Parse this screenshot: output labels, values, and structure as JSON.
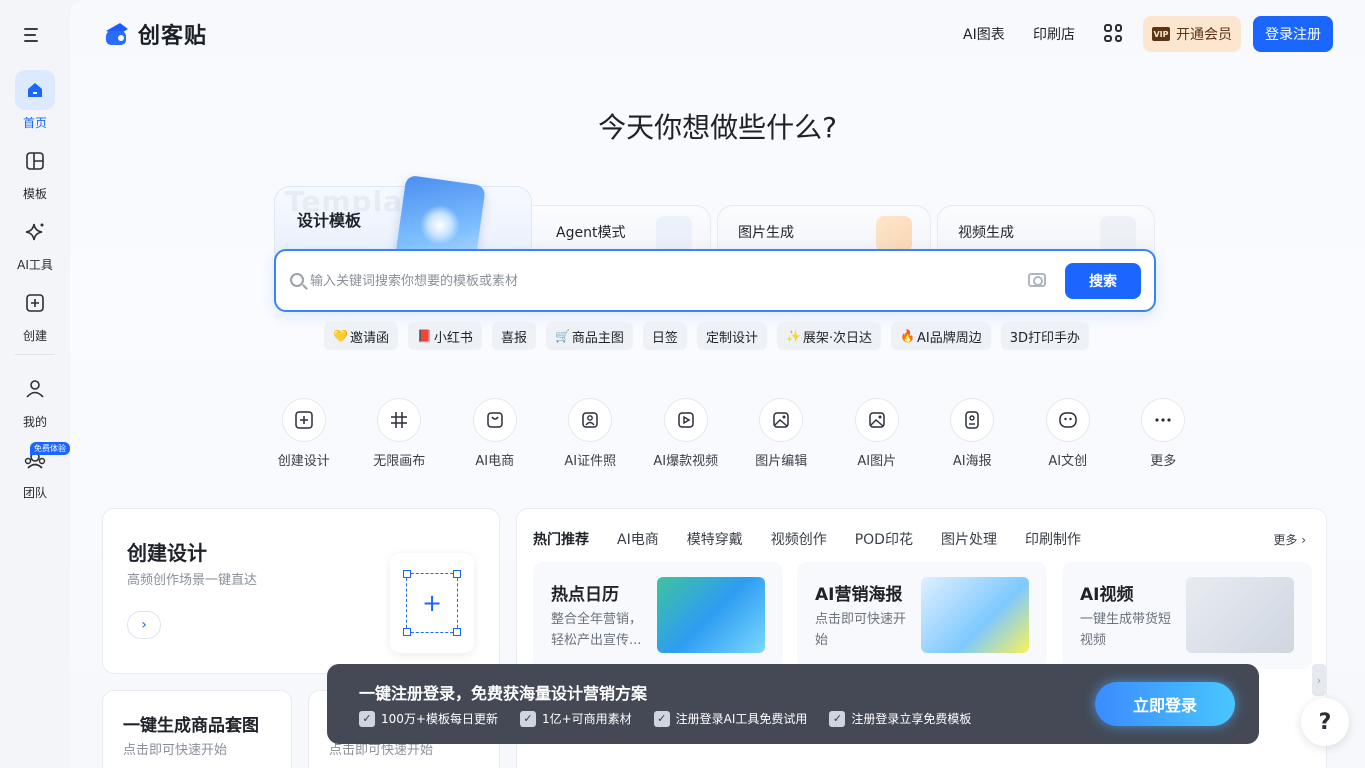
{
  "sidebar": {
    "items": [
      {
        "label": "首页",
        "icon": "home-icon"
      },
      {
        "label": "模板",
        "icon": "template-icon"
      },
      {
        "label": "AI工具",
        "icon": "sparkle-icon"
      },
      {
        "label": "创建",
        "icon": "plus-square-icon"
      },
      {
        "label": "我的",
        "icon": "user-icon"
      },
      {
        "label": "团队",
        "icon": "team-icon"
      }
    ],
    "team_badge": "免费体验"
  },
  "header": {
    "logo_text": "创客贴",
    "links": [
      "AI图表",
      "印刷店"
    ],
    "vip_badge": "VIP",
    "vip_label": "开通会员",
    "login_label": "登录注册"
  },
  "hero": {
    "title": "今天你想做些什么?",
    "tabs": [
      {
        "label": "设计模板",
        "ghost": "Template"
      },
      {
        "label": "Agent模式"
      },
      {
        "label": "图片生成"
      },
      {
        "label": "视频生成"
      }
    ],
    "search_placeholder": "输入关键词搜索你想要的模板或素材",
    "search_button": "搜索",
    "chips": [
      {
        "emoji": "💛",
        "label": "邀请函"
      },
      {
        "emoji": "📕",
        "label": "小红书"
      },
      {
        "emoji": "",
        "label": "喜报"
      },
      {
        "emoji": "🛒",
        "label": "商品主图"
      },
      {
        "emoji": "",
        "label": "日签"
      },
      {
        "emoji": "",
        "label": "定制设计"
      },
      {
        "emoji": "✨",
        "label": "展架·次日达"
      },
      {
        "emoji": "🔥",
        "label": "AI品牌周边"
      },
      {
        "emoji": "",
        "label": "3D打印手办"
      }
    ]
  },
  "tools": [
    {
      "label": "创建设计",
      "icon": "plus-square-icon"
    },
    {
      "label": "无限画布",
      "icon": "hash-icon"
    },
    {
      "label": "AI电商",
      "icon": "shopping-bag-icon"
    },
    {
      "label": "AI证件照",
      "icon": "id-photo-icon"
    },
    {
      "label": "AI爆款视频",
      "icon": "video-icon"
    },
    {
      "label": "图片编辑",
      "icon": "image-edit-icon"
    },
    {
      "label": "AI图片",
      "icon": "image-icon"
    },
    {
      "label": "AI海报",
      "icon": "poster-icon"
    },
    {
      "label": "AI文创",
      "icon": "smile-icon"
    },
    {
      "label": "更多",
      "icon": "more-icon"
    }
  ],
  "create_card": {
    "title": "创建设计",
    "subtitle": "高频创作场景一键直达"
  },
  "mini_cards": [
    {
      "title": "一键生成商品套图",
      "subtitle": "点击即可快速开始"
    },
    {
      "title": "",
      "subtitle": "点击即可快速开始"
    }
  ],
  "panel": {
    "tabs": [
      "热门推荐",
      "AI电商",
      "模特穿戴",
      "视频创作",
      "POD印花",
      "图片处理",
      "印刷制作"
    ],
    "more": "更多",
    "cards": [
      {
        "title": "热点日历",
        "subtitle": "整合全年营销，轻松产出宣传..."
      },
      {
        "title": "AI营销海报",
        "subtitle": "点击即可快速开始"
      },
      {
        "title": "AI视频",
        "subtitle": "一键生成带货短视频"
      }
    ]
  },
  "login_bar": {
    "title": "一键注册登录，免费获海量设计营销方案",
    "features": [
      "100万+模板每日更新",
      "1亿+可商用素材",
      "注册登录AI工具免费试用",
      "注册登录立享免费模板"
    ],
    "button": "立即登录"
  },
  "help": "?",
  "colors": {
    "accent": "#1a66ff",
    "vip_bg": "#fde6d0"
  }
}
